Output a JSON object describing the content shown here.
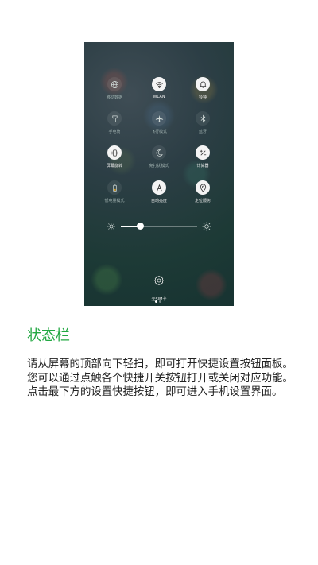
{
  "screen": {
    "tiles": [
      {
        "label": "移动数据",
        "icon": "globe-icon",
        "on": false
      },
      {
        "label": "WLAN",
        "icon": "wifi-icon",
        "on": true
      },
      {
        "label": "铃钟",
        "icon": "bell-icon",
        "on": true
      },
      {
        "label": "手电筒",
        "icon": "flashlight-icon",
        "on": false
      },
      {
        "label": "飞行模式",
        "icon": "airplane-icon",
        "on": false
      },
      {
        "label": "蓝牙",
        "icon": "bluetooth-icon",
        "on": false
      },
      {
        "label": "屏幕旋转",
        "icon": "rotate-icon",
        "on": true
      },
      {
        "label": "免打扰模式",
        "icon": "moon-icon",
        "on": false
      },
      {
        "label": "计算器",
        "icon": "calculator-icon",
        "on": true
      },
      {
        "label": "低电量模式",
        "icon": "battery-icon",
        "on": false
      },
      {
        "label": "自动亮度",
        "icon": "auto-brightness-icon",
        "on": true
      },
      {
        "label": "定位服务",
        "icon": "location-pin-icon",
        "on": true
      }
    ],
    "brightness": 0.25,
    "page_dots": {
      "count": 2,
      "active": 0
    },
    "sim_status": "无SIM卡"
  },
  "section_title": "状态栏",
  "description": "请从屏幕的顶部向下轻扫，即可打开快捷设置按钮面板。您可以通过点触各个快捷开关按钮打开或关闭对应功能。点击最下方的设置快捷按钮，即可进入手机设置界面。",
  "colors": {
    "title_green": "#22a842",
    "text": "#222222",
    "tile_on": "#f4f4f4"
  }
}
